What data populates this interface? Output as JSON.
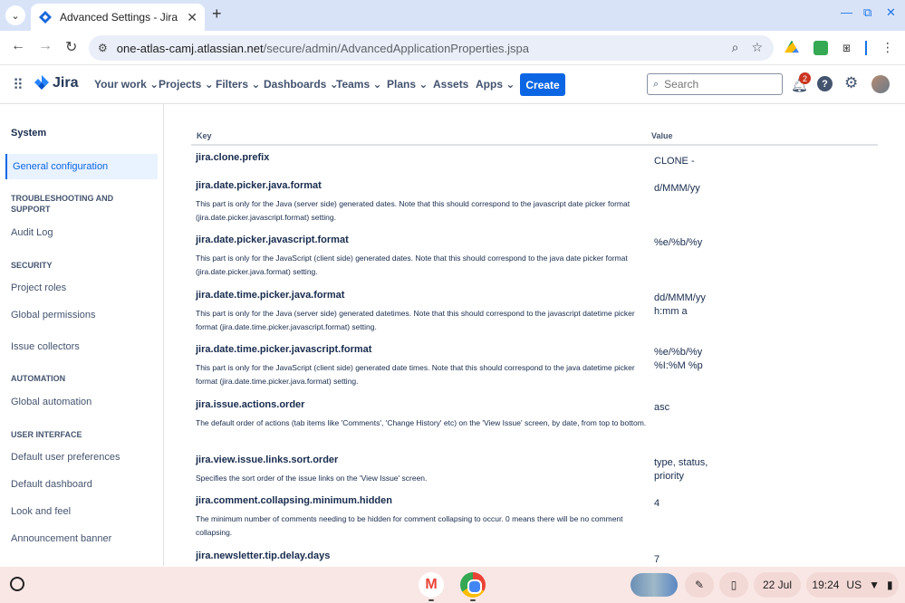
{
  "browser": {
    "tab_title": "Advanced Settings - Jira",
    "url_host": "one-atlas-camj.atlassian.net",
    "url_path": "/secure/admin/AdvancedApplicationProperties.jspa"
  },
  "nav": {
    "brand": "Jira",
    "items": [
      "Your work",
      "Projects",
      "Filters",
      "Dashboards",
      "Teams",
      "Plans",
      "Assets",
      "Apps"
    ],
    "create_label": "Create",
    "search_placeholder": "Search",
    "notification_count": "2"
  },
  "sidebar": {
    "title": "System",
    "active_item": "General configuration",
    "sections": [
      {
        "heading": "TROUBLESHOOTING AND SUPPORT",
        "items": [
          "Audit Log"
        ]
      },
      {
        "heading": "SECURITY",
        "items": [
          "Project roles",
          "Global permissions",
          "Issue collectors"
        ]
      },
      {
        "heading": "AUTOMATION",
        "items": [
          "Global automation"
        ]
      },
      {
        "heading": "USER INTERFACE",
        "items": [
          "Default user preferences",
          "Default dashboard",
          "Look and feel",
          "Announcement banner"
        ]
      }
    ]
  },
  "table": {
    "col_key": "Key",
    "col_value": "Value",
    "rows": [
      {
        "key": "jira.clone.prefix",
        "desc": "",
        "value": "CLONE -"
      },
      {
        "key": "jira.date.picker.java.format",
        "desc": "This part is only for the Java (server side) generated dates. Note that this should correspond to the javascript date picker format (jira.date.picker.javascript.format) setting.",
        "value": "d/MMM/yy"
      },
      {
        "key": "jira.date.picker.javascript.format",
        "desc": "This part is only for the JavaScript (client side) generated dates. Note that this should correspond to the java date picker format (jira.date.picker.java.format) setting.",
        "value": "%e/%b/%y"
      },
      {
        "key": "jira.date.time.picker.java.format",
        "desc": "This part is only for the Java (server side) generated datetimes. Note that this should correspond to the javascript datetime picker format (jira.date.time.picker.javascript.format) setting.",
        "value": "dd/MMM/yy h:mm a"
      },
      {
        "key": "jira.date.time.picker.javascript.format",
        "desc": "This part is only for the JavaScript (client side) generated date times. Note that this should correspond to the java datetime picker format (jira.date.time.picker.java.format) setting.",
        "value": "%e/%b/%y %I:%M %p"
      },
      {
        "key": "jira.issue.actions.order",
        "desc": "The default order of actions (tab items like 'Comments', 'Change History' etc) on the 'View Issue' screen, by date, from top to bottom.",
        "value": "asc"
      },
      {
        "key": "jira.view.issue.links.sort.order",
        "desc": "Specifies the sort order of the issue links on the 'View Issue' screen.",
        "value": "type, status, priority"
      },
      {
        "key": "jira.comment.collapsing.minimum.hidden",
        "desc": "The minimum number of comments needing to be hidden for comment collapsing to occur. 0 means there will be no comment collapsing.",
        "value": "4"
      },
      {
        "key": "jira.newsletter.tip.delay.days",
        "desc": "",
        "value": "7"
      }
    ]
  },
  "shelf": {
    "date": "22 Jul",
    "time": "19:24",
    "locale": "US"
  }
}
